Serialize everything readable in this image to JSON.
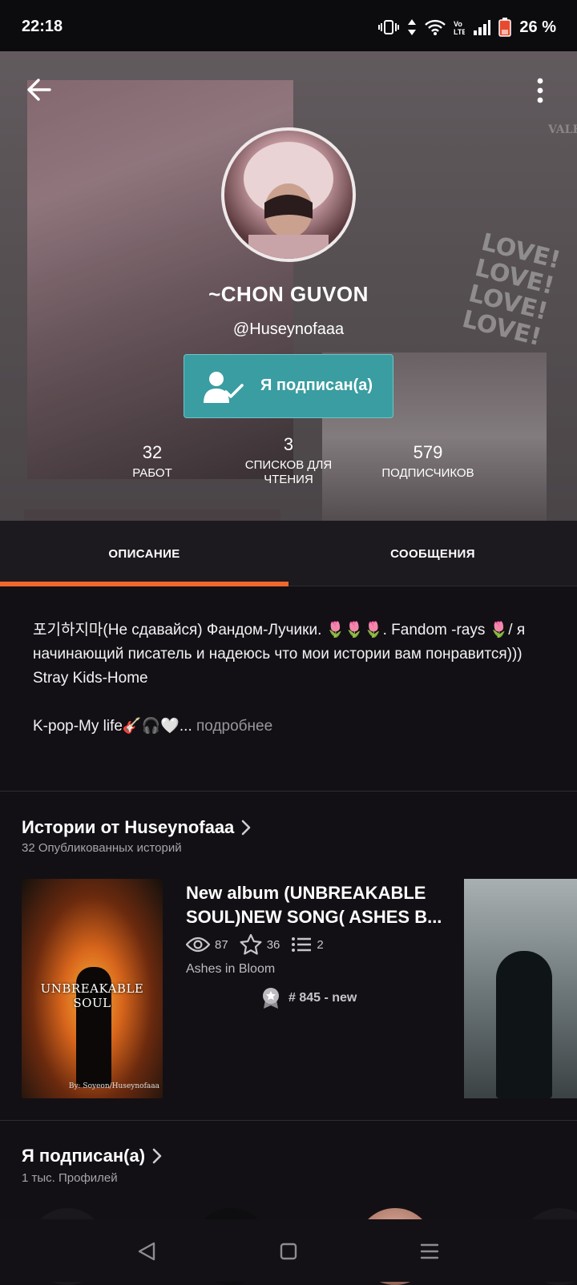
{
  "status_bar": {
    "time": "22:18",
    "battery": "26 %",
    "icons": [
      "vibrate-icon",
      "data-arrows-icon",
      "wifi-icon",
      "volte-icon",
      "signal-icon",
      "battery-icon"
    ]
  },
  "profile": {
    "display_name": "~CHON GUVON",
    "username": "@Huseynofaaa",
    "follow_label": "Я подписан(а)",
    "hero_love_text": "LOVE!\nLOVE!\nLOVE!\nLOVE!",
    "hero_vale_text": "VALE",
    "stats": [
      {
        "value": "32",
        "label": "РАБОТ"
      },
      {
        "value": "3",
        "label": "СПИСКОВ ДЛЯ ЧТЕНИЯ"
      },
      {
        "value": "579",
        "label": "ПОДПИСЧИКОВ"
      }
    ]
  },
  "tabs": [
    {
      "label": "ОПИСАНИЕ",
      "active": true
    },
    {
      "label": "СООБЩЕНИЯ",
      "active": false
    }
  ],
  "description": {
    "text": "포기하지마(Не сдавайся) Фандом-Лучики. 🌷🌷🌷. Fandom -rays 🌷/ я начинающий писатель и надеюсь что мои истории вам понравится))) Stray Kids-Home",
    "text2": "K-pop-My life🎸🎧🤍...",
    "more": " подробнее"
  },
  "stories_section": {
    "title": "Истории от Huseynofaaa",
    "subtitle": "32 Опубликованных историй",
    "story": {
      "cover_title": "UNBREAKABLE SOUL",
      "cover_byline": "By: Soyeon/Huseynofaaa",
      "title": "New album (UNBREAKABLE SOUL)NEW SONG( ASHES B...",
      "views": "87",
      "votes": "36",
      "parts": "2",
      "tag": "Ashes in Bloom",
      "rank": "# 845 - new"
    }
  },
  "following_section": {
    "title": "Я подписан(а)",
    "subtitle": "1 тыс. Профилей"
  },
  "colors": {
    "accent": "#f1672e",
    "follow_button": "#3a9da1",
    "background": "#121015"
  }
}
